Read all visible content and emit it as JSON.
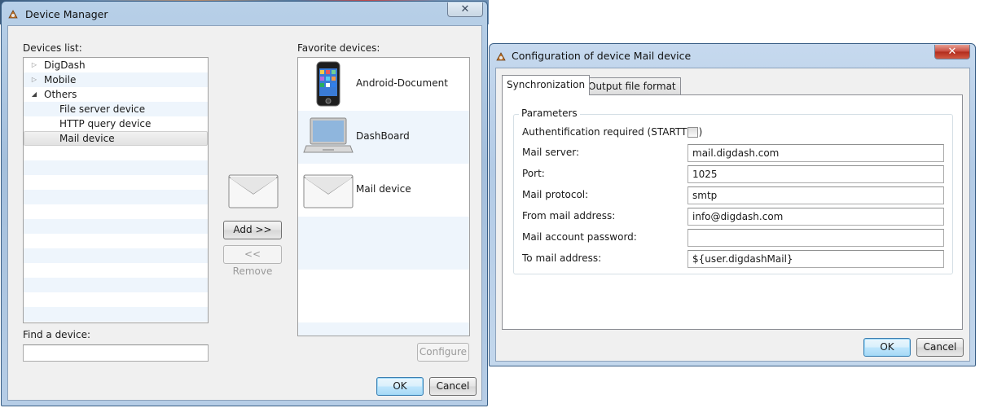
{
  "device_manager": {
    "title": "Device Manager",
    "close_glyph": "✕",
    "devices_list_label": "Devices list:",
    "tree": [
      {
        "label": "DigDash",
        "expanded": false
      },
      {
        "label": "Mobile",
        "expanded": false
      },
      {
        "label": "Others",
        "expanded": true
      },
      {
        "label": "File server device"
      },
      {
        "label": "HTTP query device"
      },
      {
        "label": "Mail device",
        "selected": true
      }
    ],
    "find_label": "Find a device:",
    "find_value": "",
    "add_button": "Add >>",
    "remove_button": "<< Remove",
    "favorites_label": "Favorite devices:",
    "favorites": [
      {
        "name": "Android-Document",
        "icon": "phone-icon"
      },
      {
        "name": "DashBoard",
        "icon": "laptop-icon"
      },
      {
        "name": "Mail device",
        "icon": "envelope-icon"
      }
    ],
    "configure_button": "Configure",
    "ok_button": "OK",
    "cancel_button": "Cancel"
  },
  "config_dialog": {
    "title": "Configuration of device Mail device",
    "close_glyph": "✕",
    "tabs": [
      {
        "label": "Synchronization",
        "active": true
      },
      {
        "label": "Output file format",
        "active": false
      }
    ],
    "group_title": "Parameters",
    "auth_label": "Authentification required (STARTTLS)",
    "auth_checked": false,
    "fields": [
      {
        "label": "Mail server:",
        "value": "mail.digdash.com"
      },
      {
        "label": "Port:",
        "value": "1025"
      },
      {
        "label": "Mail protocol:",
        "value": "smtp"
      },
      {
        "label": "From mail address:",
        "value": "info@digdash.com"
      },
      {
        "label": "Mail account password:",
        "value": ""
      },
      {
        "label": "To mail address:",
        "value": "${user.digdashMail}"
      }
    ],
    "ok_button": "OK",
    "cancel_button": "Cancel"
  },
  "colors": {
    "frame_left": "#a9c4e0",
    "frame_right": "#bcd3ea",
    "close_red": "#c7493d",
    "list_alt_row": "#eef5fc",
    "default_button_border": "#3c7fb1"
  }
}
